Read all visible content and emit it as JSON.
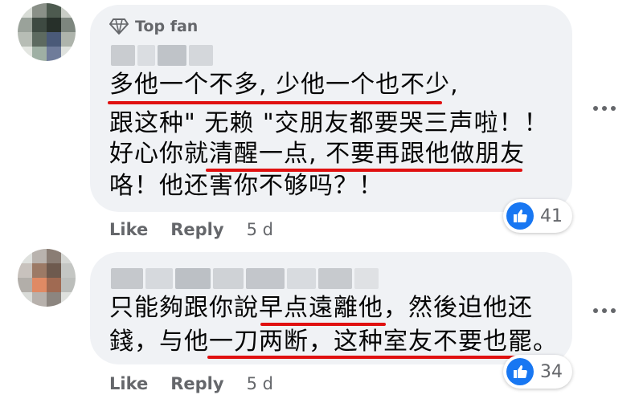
{
  "comments": [
    {
      "badge_label": "Top fan",
      "lines": [
        "多他一个不多, 少他一个也不少,",
        "跟这种\" 无赖 \"交朋友都要哭三声啦！！",
        "好心你就清醒一点, 不要再跟他做朋友",
        "咯！他还害你不够吗？！"
      ],
      "like_label": "Like",
      "reply_label": "Reply",
      "time": "5 d",
      "reaction_count": "41"
    },
    {
      "lines": [
        "只能夠跟你說早点遠離他，然後迫他还",
        "錢，与他一刀两断，这种室友不要也罷。"
      ],
      "like_label": "Like",
      "reply_label": "Reply",
      "time": "5 d",
      "reaction_count": "34"
    }
  ],
  "colors": {
    "bubble": "#f0f2f5",
    "text": "#050505",
    "secondary": "#65676b",
    "like_blue": "#1877f2",
    "highlight_red": "#e01010"
  },
  "icons": {
    "top_fan": "diamond-icon",
    "reaction": "thumbs-up-icon",
    "more": "more-options-icon"
  }
}
